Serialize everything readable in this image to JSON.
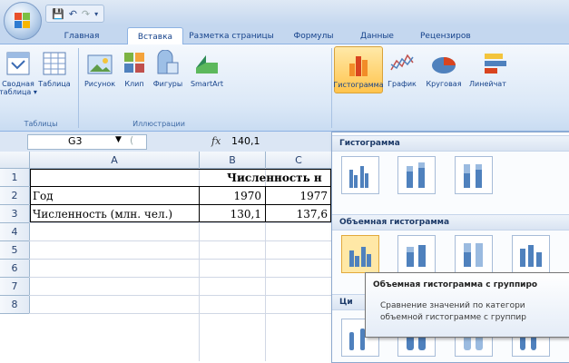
{
  "quick_access": {
    "save_icon": "save-icon",
    "undo_icon": "undo-icon",
    "redo_icon": "redo-icon"
  },
  "tabs": [
    "Главная",
    "Вставка",
    "Разметка страницы",
    "Формулы",
    "Данные",
    "Рецензиров"
  ],
  "active_tab": "Вставка",
  "ribbon": {
    "tables": {
      "pivot": "Сводная\nтаблица ▾",
      "table": "Таблица",
      "group": "Таблицы"
    },
    "illustrations": {
      "picture": "Рисунок",
      "clip": "Клип",
      "shapes": "Фигуры",
      "smartart": "SmartArt",
      "group": "Иллюстрации"
    },
    "charts": {
      "histogram": "Гистограмма",
      "graph": "График",
      "pie": "Круговая",
      "line": "Линейчат"
    }
  },
  "formula_bar": {
    "cell_ref": "G3",
    "fx": "fx",
    "value": "140,1"
  },
  "columns": [
    "A",
    "B",
    "C"
  ],
  "rows": [
    "1",
    "2",
    "3",
    "4",
    "5",
    "6",
    "7",
    "8"
  ],
  "cells": {
    "title": "Численность н",
    "year_label": "Год",
    "pop_label": "Численность (млн. чел.)",
    "b2": "1970",
    "c2": "1977",
    "b3": "130,1",
    "c3": "137,6"
  },
  "gallery": {
    "section1": "Гистограмма",
    "section2": "Объемная гистограмма",
    "section3": "Ци"
  },
  "tooltip": {
    "title": "Объемная гистограмма с группиро",
    "line1": "Сравнение значений по категори",
    "line2": "объемной гистограмме с группир"
  },
  "colors": {
    "accent": "#15428b",
    "ribbon_bg": "#dbe8f7",
    "highlight": "#ffe8a6",
    "chart_blue": "#4f81bd"
  }
}
